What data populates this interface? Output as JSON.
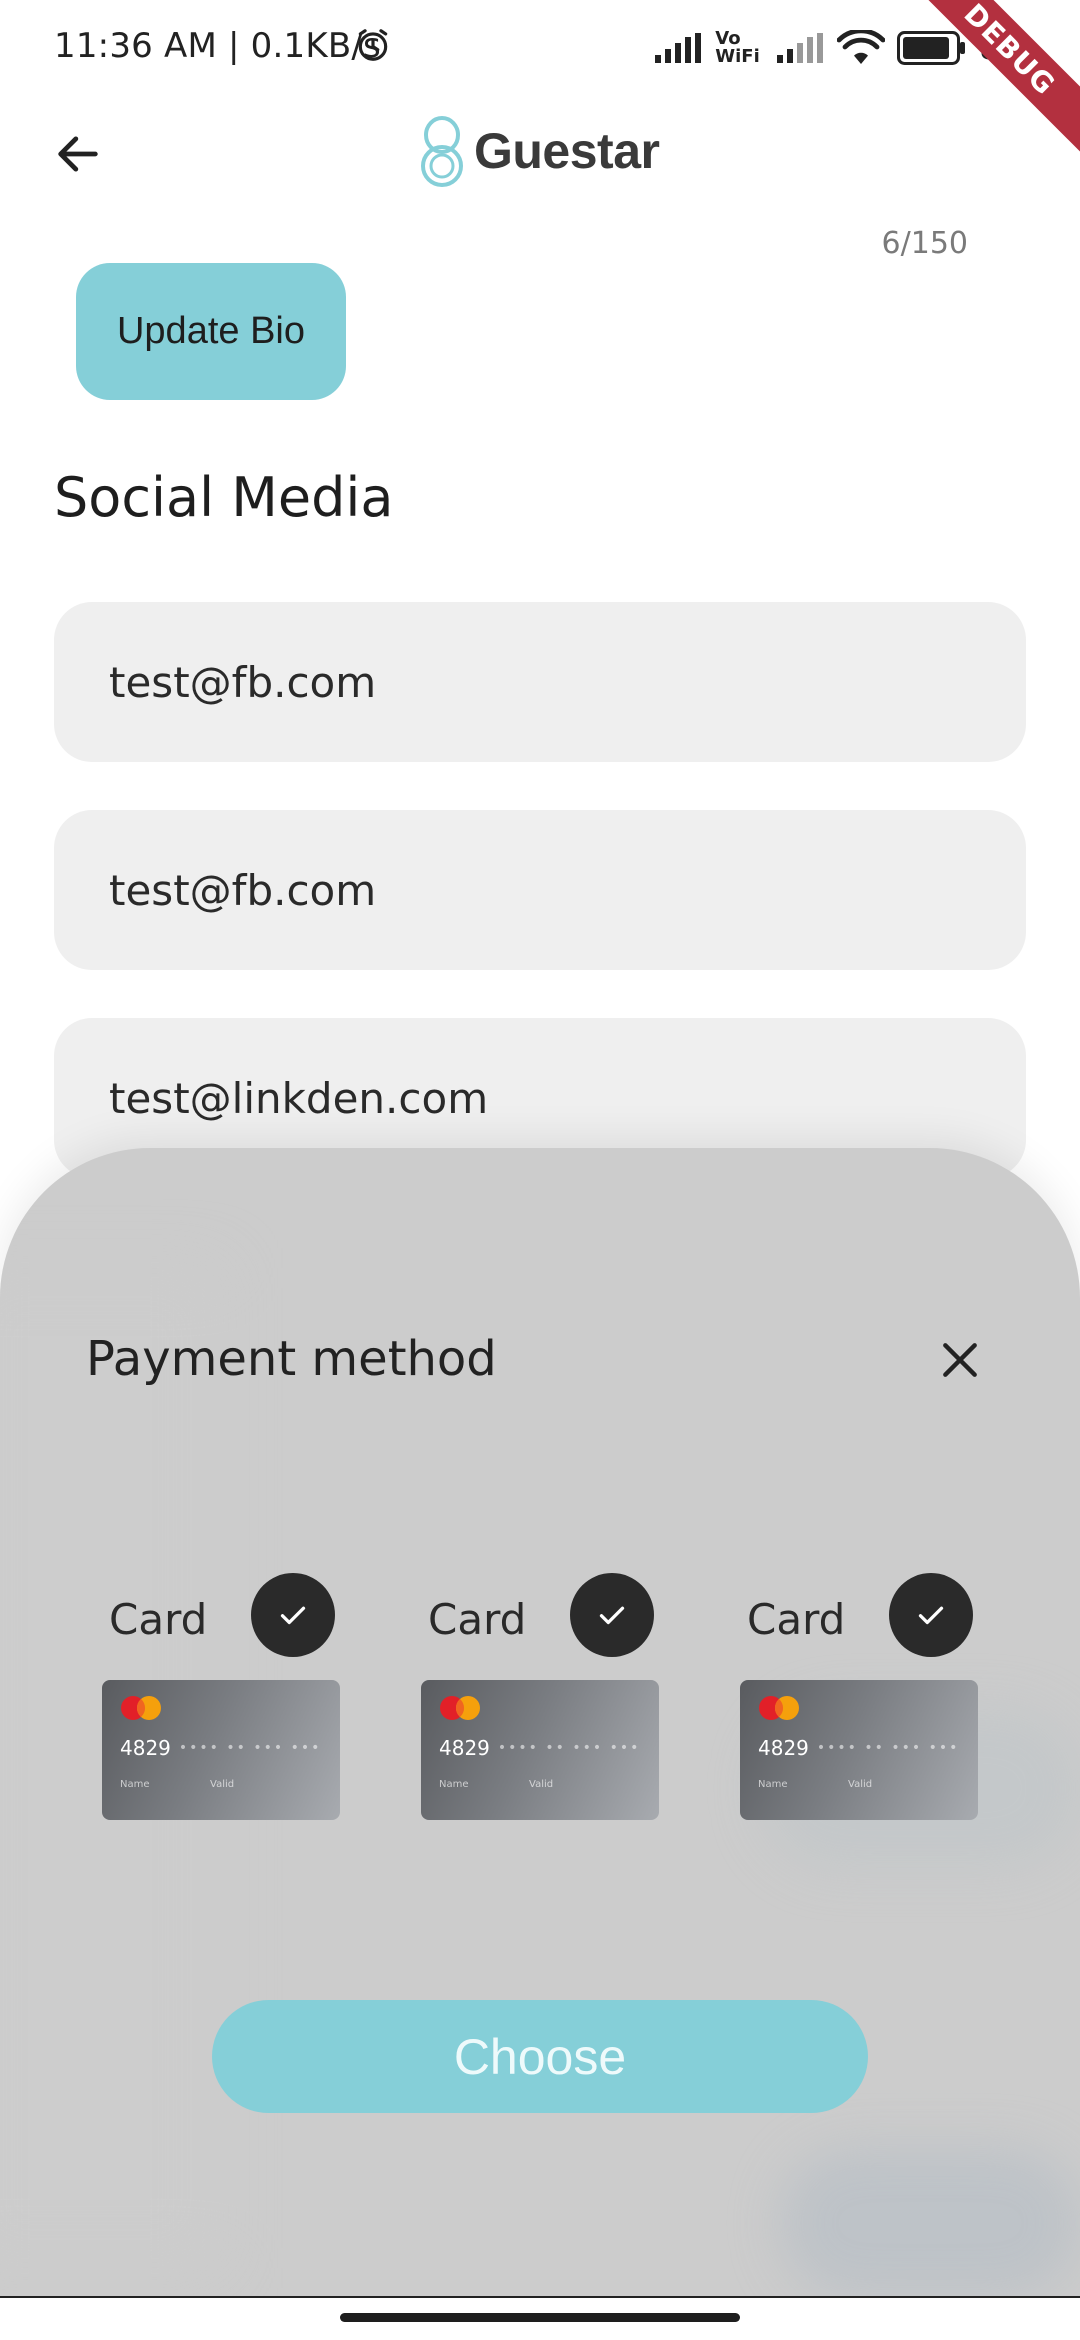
{
  "status_bar": {
    "time": "11:36 AM | 0.1KB/s",
    "battery": "86",
    "alarm_icon": "alarm-clock-icon",
    "signal_icon": "cell-signal-icon",
    "volte_label": "Vo WiFi",
    "wifi_icon": "wifi-icon",
    "battery_icon": "battery-icon"
  },
  "debug_banner": "DEBUG",
  "header": {
    "back_icon": "arrow-left-icon",
    "logo_text": "Guestar"
  },
  "bio": {
    "char_count": "6/150",
    "update_label": "Update Bio"
  },
  "social_media": {
    "title": "Social Media",
    "fields": [
      {
        "value": "test@fb.com"
      },
      {
        "value": "test@fb.com"
      },
      {
        "value": "test@linkden.com"
      }
    ]
  },
  "payment_sheet": {
    "title": "Payment method",
    "close_icon": "close-icon",
    "cards": [
      {
        "label": "Card",
        "selected": true,
        "number_prefix": "4829",
        "masked": "•••• •• ••• •••",
        "name_label": "Name",
        "valid_label": "Valid"
      },
      {
        "label": "Card",
        "selected": true,
        "number_prefix": "4829",
        "masked": "•••• •• ••• •••",
        "name_label": "Name",
        "valid_label": "Valid"
      },
      {
        "label": "Card",
        "selected": true,
        "number_prefix": "4829",
        "masked": "•••• •• ••• •••",
        "name_label": "Name",
        "valid_label": "Valid"
      }
    ],
    "choose_label": "Choose"
  },
  "colors": {
    "accent": "#85cfd8",
    "sheet_background": "#cccccc",
    "field_background": "#efefef",
    "debug_ribbon": "#b3303f"
  }
}
